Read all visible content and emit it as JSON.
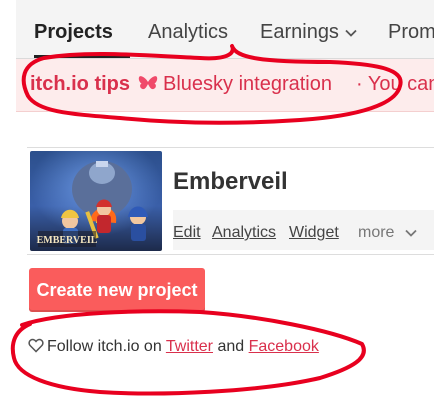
{
  "nav": {
    "tabs": [
      {
        "label": "Projects",
        "active": true
      },
      {
        "label": "Analytics"
      },
      {
        "label": "Earnings"
      },
      {
        "label": "Prom"
      }
    ]
  },
  "tips": {
    "label": "itch.io tips",
    "link_text": "Bluesky integration",
    "separator": "·",
    "trailing_text": "You can us",
    "icon": "butterfly-icon"
  },
  "project": {
    "title": "Emberveil",
    "cover_logo": "EMBERVEIL",
    "actions": [
      "Edit",
      "Analytics",
      "Widget"
    ],
    "more_label": "more"
  },
  "create_button": {
    "label": "Create new project"
  },
  "follow": {
    "icon": "heart-icon",
    "prefix": "Follow itch.io on",
    "twitter": "Twitter",
    "and": "and",
    "facebook": "Facebook"
  },
  "colors": {
    "brand_red": "#fa5c5c",
    "link_red": "#d9304c",
    "annotation_red": "#e8001f",
    "tips_bg": "#fdecec"
  }
}
